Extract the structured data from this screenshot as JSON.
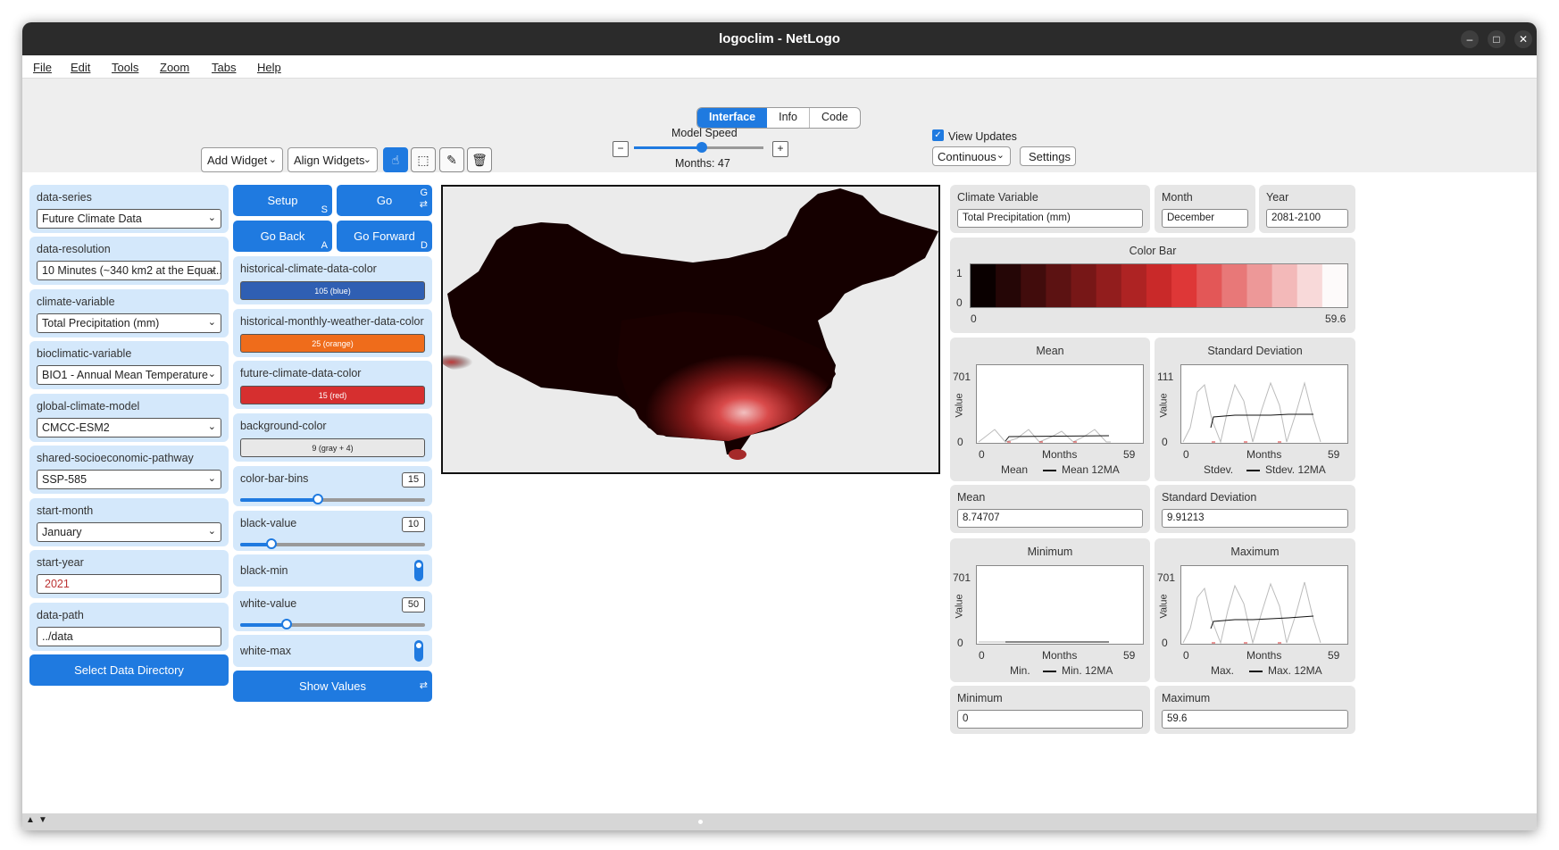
{
  "window": {
    "title": "logoclim - NetLogo"
  },
  "menu": [
    "File",
    "Edit",
    "Tools",
    "Zoom",
    "Tabs",
    "Help"
  ],
  "tabs": [
    "Interface",
    "Info",
    "Code"
  ],
  "toolbar": {
    "add_widget": "Add Widget",
    "align_widgets": "Align Widgets",
    "model_speed_label": "Model Speed",
    "ticks_label": "Months: 47",
    "view_updates": "View Updates",
    "update_mode": "Continuous",
    "settings": "Settings",
    "minus": "−",
    "plus": "+"
  },
  "chooser": [
    {
      "label": "data-series",
      "value": "Future Climate Data"
    },
    {
      "label": "data-resolution",
      "value": "10 Minutes (~340 km2 at the Equat..."
    },
    {
      "label": "climate-variable",
      "value": "Total Precipitation (mm)"
    },
    {
      "label": "bioclimatic-variable",
      "value": "BIO1 - Annual Mean Temperature"
    },
    {
      "label": "global-climate-model",
      "value": "CMCC-ESM2"
    },
    {
      "label": "shared-socioeconomic-pathway",
      "value": "SSP-585"
    },
    {
      "label": "start-month",
      "value": "January"
    }
  ],
  "inputs": {
    "start_year": {
      "label": "start-year",
      "value": "2021"
    },
    "data_path": {
      "label": "data-path",
      "value": "../data"
    }
  },
  "select_dir": "Select Data Directory",
  "buttons": {
    "setup": "Setup",
    "setup_key": "S",
    "go": "Go",
    "go_key": "G",
    "go_back": "Go Back",
    "go_back_key": "A",
    "go_forward": "Go Forward",
    "go_forward_key": "D",
    "show_values": "Show Values"
  },
  "colors": [
    {
      "label": "historical-climate-data-color",
      "value": "105 (blue)",
      "hex": "#2f5fb3"
    },
    {
      "label": "historical-monthly-weather-data-color",
      "value": "25 (orange)",
      "hex": "#ef6c1b"
    },
    {
      "label": "future-climate-data-color",
      "value": "15 (red)",
      "hex": "#d62f2f"
    },
    {
      "label": "background-color",
      "value": "9 (gray + 4)",
      "hex": "#e8e8e8"
    }
  ],
  "sliders": {
    "color_bar_bins": {
      "label": "color-bar-bins",
      "value": "15",
      "fraction": 0.42
    },
    "black_value": {
      "label": "black-value",
      "value": "10",
      "fraction": 0.17
    },
    "white_value": {
      "label": "white-value",
      "value": "50",
      "fraction": 0.25
    }
  },
  "switches": {
    "black_min": {
      "label": "black-min",
      "on": true
    },
    "white_max": {
      "label": "white-max",
      "on": true
    }
  },
  "monitors": {
    "climate_variable": {
      "label": "Climate Variable",
      "value": "Total Precipitation (mm)"
    },
    "month": {
      "label": "Month",
      "value": "December"
    },
    "year": {
      "label": "Year",
      "value": "2081-2100"
    },
    "mean": {
      "label": "Mean",
      "value": "8.74707"
    },
    "stdev": {
      "label": "Standard Deviation",
      "value": "9.91213"
    },
    "minimum": {
      "label": "Minimum",
      "value": "0"
    },
    "maximum": {
      "label": "Maximum",
      "value": "59.6"
    }
  },
  "colorbar": {
    "title": "Color Bar",
    "ymax": "1",
    "ymin": "0",
    "xmin": "0",
    "xmax": "59.6"
  },
  "plots": {
    "mean": {
      "title": "Mean",
      "ymax": "701",
      "ymin": "0",
      "xmin": "0",
      "xmax": "59",
      "xlabel": "Months",
      "ylabel": "Value",
      "legend1": "Mean",
      "legend2": "Mean 12MA"
    },
    "stdev": {
      "title": "Standard Deviation",
      "ymax": "111",
      "ymin": "0",
      "xmin": "0",
      "xmax": "59",
      "xlabel": "Months",
      "ylabel": "Value",
      "legend1": "Stdev.",
      "legend2": "Stdev. 12MA"
    },
    "min": {
      "title": "Minimum",
      "ymax": "701",
      "ymin": "0",
      "xmin": "0",
      "xmax": "59",
      "xlabel": "Months",
      "ylabel": "Value",
      "legend1": "Min.",
      "legend2": "Min. 12MA"
    },
    "max": {
      "title": "Maximum",
      "ymax": "701",
      "ymin": "0",
      "xmin": "0",
      "xmax": "59",
      "xlabel": "Months",
      "ylabel": "Value",
      "legend1": "Max.",
      "legend2": "Max. 12MA"
    }
  }
}
